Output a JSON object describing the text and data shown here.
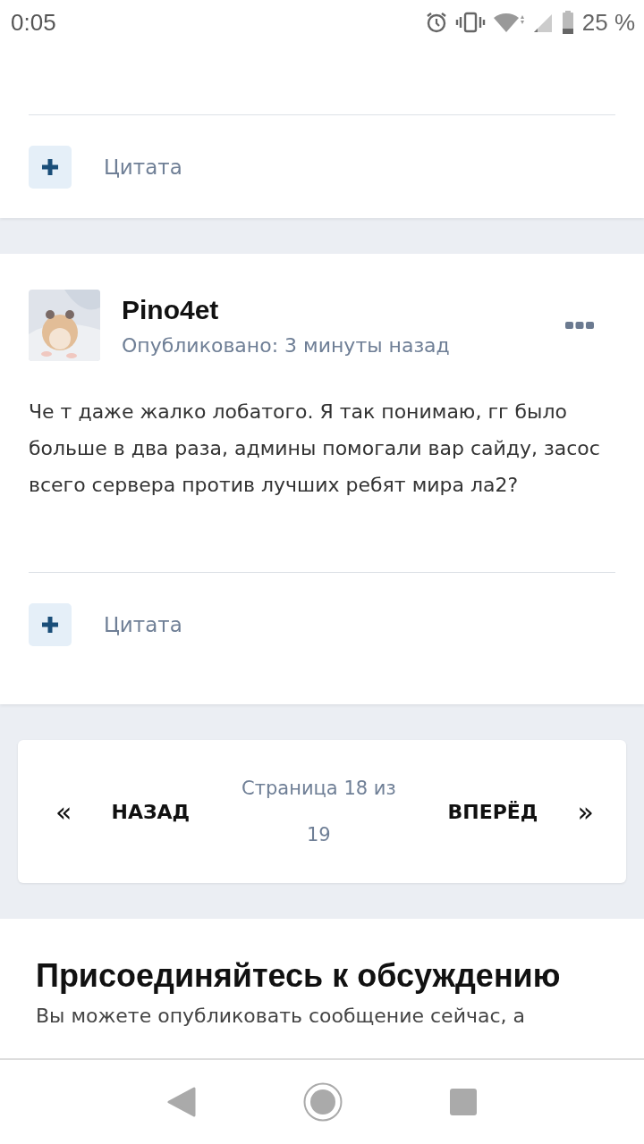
{
  "status_bar": {
    "time": "0:05",
    "battery": "25 %"
  },
  "posts": [
    {
      "kind": "partial",
      "quote": "Цитата"
    },
    {
      "kind": "full",
      "author": "Pino4et",
      "published": "Опубликовано: 3 минуты назад",
      "body": "Че т даже жалко лобатого. Я так понимаю, гг было больше в два раза, админы помогали вар сайду, засос всего сервера против лучших ребят мира ла2?",
      "quote": "Цитата"
    }
  ],
  "pagination": {
    "prev_icon": "«",
    "prev": "НАЗАД",
    "page_info": "Страница 18 из 19",
    "next": "ВПЕРЁД",
    "next_icon": "»"
  },
  "join": {
    "title": "Присоединяйтесь к обсуждению",
    "text": "Вы можете опубликовать сообщение сейчас, а"
  }
}
